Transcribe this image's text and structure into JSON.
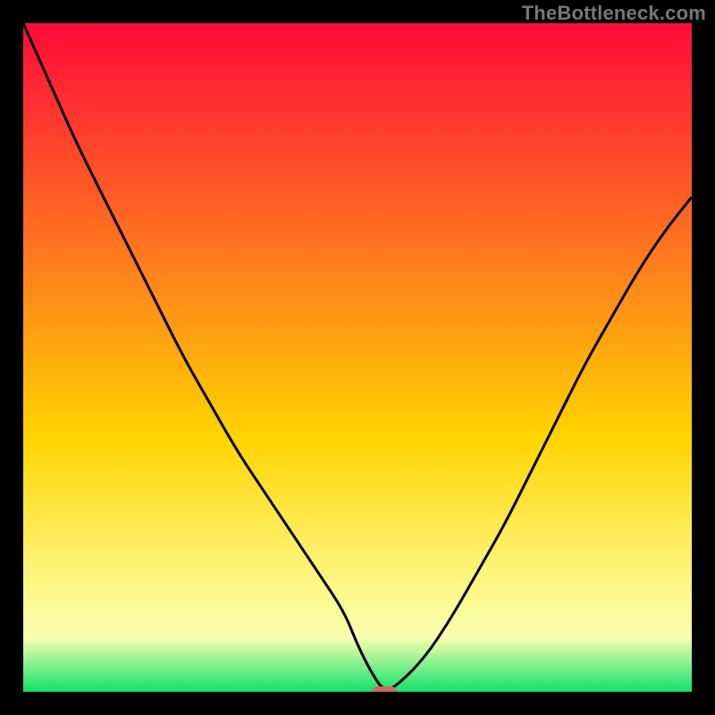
{
  "attribution": "TheBottleneck.com",
  "colors": {
    "top": "#ff0a3a",
    "mid_upper": "#ff7a1e",
    "mid": "#ffd400",
    "mid_lower": "#fff47a",
    "lower": "#f7ffb0",
    "bottom": "#12e06a",
    "curve": "#000000",
    "marker": "#cf6a61",
    "frame": "#000000"
  },
  "chart_data": {
    "type": "line",
    "title": "",
    "xlabel": "",
    "ylabel": "",
    "xlim": [
      0,
      100
    ],
    "ylim": [
      0,
      100
    ],
    "grid": false,
    "legend": false,
    "annotations": [],
    "series": [
      {
        "name": "bottleneck_curve",
        "x": [
          0,
          4,
          8,
          12,
          16,
          20,
          24,
          28,
          32,
          36,
          40,
          44,
          48,
          50,
          52,
          54,
          56,
          60,
          64,
          68,
          72,
          76,
          80,
          84,
          88,
          92,
          96,
          100
        ],
        "values": [
          100,
          91,
          82,
          74,
          66,
          58,
          50,
          43,
          36,
          30,
          24,
          18,
          12,
          7,
          3,
          0,
          1,
          5,
          11,
          18,
          25,
          33,
          41,
          49,
          56,
          63,
          69,
          74
        ]
      }
    ],
    "marker": {
      "x": 54,
      "y": 0
    },
    "gradient_stops": [
      {
        "pct": 0,
        "color": "#ff0a3a"
      },
      {
        "pct": 35,
        "color": "#ff7a1e"
      },
      {
        "pct": 62,
        "color": "#ffd400"
      },
      {
        "pct": 82,
        "color": "#fff47a"
      },
      {
        "pct": 92,
        "color": "#f7ffb0"
      },
      {
        "pct": 100,
        "color": "#12e06a"
      }
    ]
  }
}
